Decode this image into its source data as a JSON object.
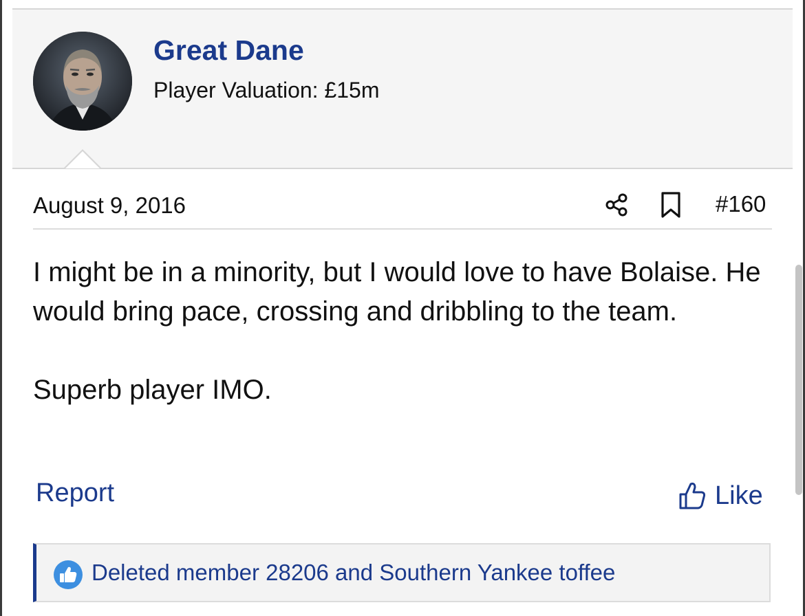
{
  "post": {
    "author": {
      "name": "Great Dane",
      "valuation": "Player Valuation: £15m",
      "avatar": "avatar-photo"
    },
    "date": "August 9, 2016",
    "number": "#160",
    "paragraphs": [
      "I might be in a minority, but I would love to have Bolaise. He would bring pace, crossing and dribbling to the team.",
      "Superb player IMO."
    ],
    "actions": {
      "report_label": "Report",
      "like_label": "Like"
    },
    "likes_summary": "Deleted member 28206 and Southern Yankee toffee"
  },
  "icons": {
    "share": "share-icon",
    "bookmark": "bookmark-icon",
    "like": "thumbs-up-icon",
    "likes_badge": "thumbs-up-badge-icon"
  },
  "colors": {
    "link": "#1b3a8c",
    "header_bg": "#f5f5f5",
    "likes_badge_bg": "#3d8fe0"
  }
}
